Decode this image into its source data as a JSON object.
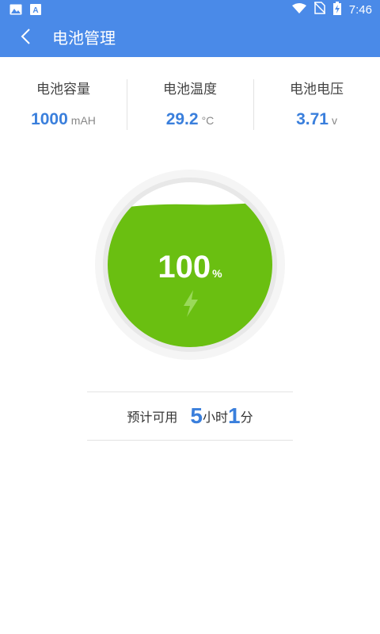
{
  "status_bar": {
    "time": "7:46",
    "icons": [
      "image-icon",
      "a-notification-icon",
      "wifi-icon",
      "no-sim-icon",
      "battery-charging-icon"
    ]
  },
  "app_bar": {
    "title": "电池管理",
    "back_icon": "chevron-left-icon"
  },
  "stats": [
    {
      "label": "电池容量",
      "value": "1000",
      "unit": "mAH"
    },
    {
      "label": "电池温度",
      "value": "29.2",
      "unit": "°C"
    },
    {
      "label": "电池电压",
      "value": "3.71",
      "unit": "v"
    }
  ],
  "battery": {
    "level": "100",
    "level_unit": "%",
    "charging_icon": "lightning-bolt-icon",
    "fill_color": "#6abf11"
  },
  "estimate": {
    "label": "预计可用",
    "hours": "5",
    "hours_unit": "小时",
    "minutes": "1",
    "minutes_unit": "分"
  },
  "colors": {
    "primary": "#4a8ae8",
    "accent_text": "#3a7fdc",
    "battery_green": "#6abf11"
  }
}
